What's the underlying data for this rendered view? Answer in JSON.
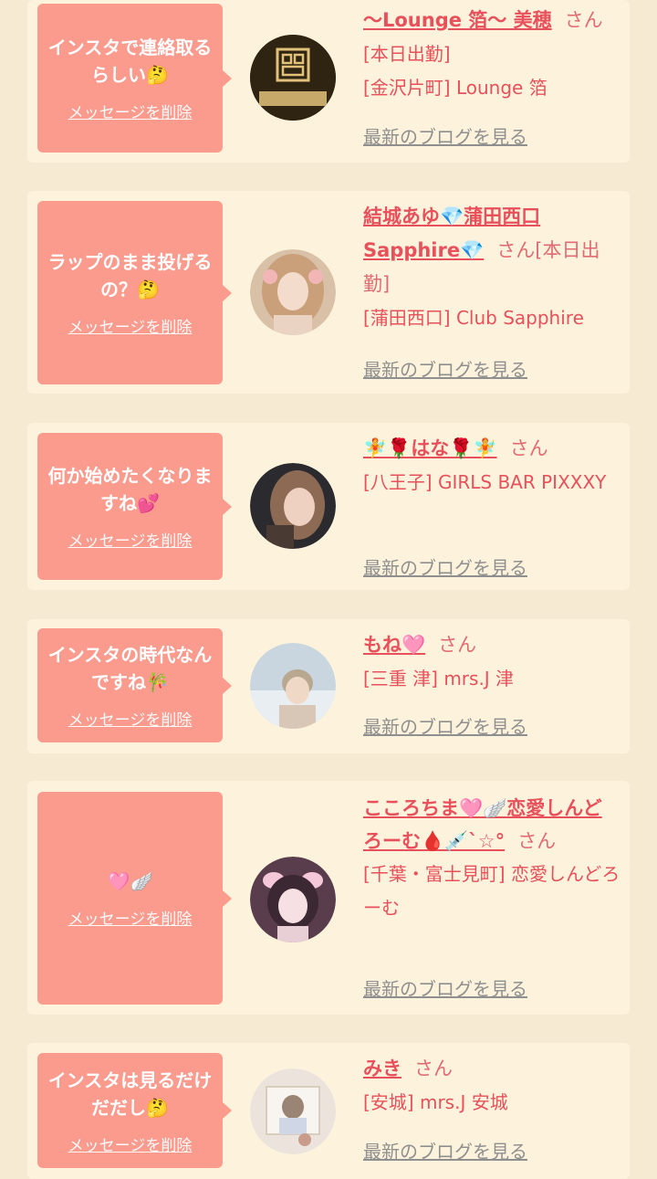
{
  "del_label": "メッセージを削除",
  "san_label": "さん",
  "blog_label": "最新のブログを見る",
  "colors": {
    "page_bg": "#f6ead3",
    "card_bg": "#fdf3dc",
    "bubble": "#fb9b8e",
    "name": "#e8505b",
    "blog_link": "#8f8f8f"
  },
  "cards": [
    {
      "msg": "インスタで連絡取るらしい🤔",
      "name": "〜Lounge 箔〜 美穂",
      "lines": [
        "[本日出勤]",
        "[金沢片町] Lounge 箔"
      ],
      "avatar": "lounge-logo"
    },
    {
      "msg": "ラップのまま投げるの？🤔",
      "name": "結城あゆ💎蒲田西口Sapphire💎",
      "lines": [
        "[本日出勤]",
        "[蒲田西口] Club Sapphire"
      ],
      "avatar": "photo"
    },
    {
      "msg": "何か始めたくなりますね💕",
      "name": "🧚🌹はな🌹🧚",
      "lines": [
        "[八王子] GIRLS BAR PIXXXY"
      ],
      "avatar": "photo"
    },
    {
      "msg": "インスタの時代なんですね🎋",
      "name": "もね🩷",
      "lines": [
        "[三重 津] mrs.J 津"
      ],
      "avatar": "photo"
    },
    {
      "msg": "🩷🪽",
      "name": "こころちま🩷🪽恋愛しんどろーむ🩸💉`☆°",
      "lines": [
        "[千葉・富士見町] 恋愛しんどろーむ"
      ],
      "avatar": "photo"
    },
    {
      "msg": "インスタは見るだけだだし🤔",
      "name": "みき",
      "lines": [
        "[安城] mrs.J 安城"
      ],
      "avatar": "photo"
    }
  ]
}
